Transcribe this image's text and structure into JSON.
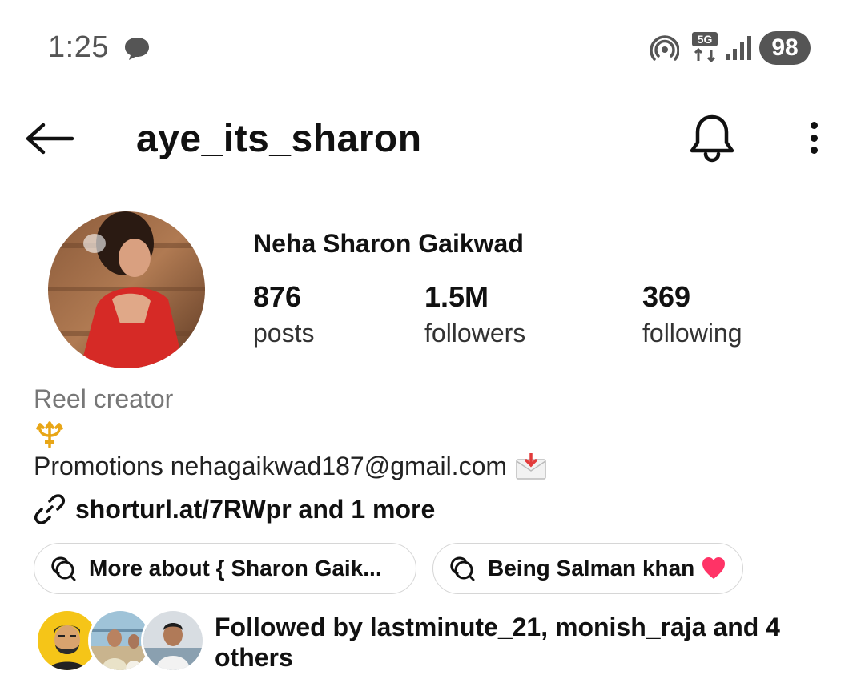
{
  "status_bar": {
    "time": "1:25",
    "network": "5G",
    "battery": "98"
  },
  "header": {
    "username": "aye_its_sharon"
  },
  "profile": {
    "display_name": "Neha Sharon Gaikwad",
    "stats": {
      "posts": {
        "value": "876",
        "label": "posts"
      },
      "followers": {
        "value": "1.5M",
        "label": "followers"
      },
      "following": {
        "value": "369",
        "label": "following"
      }
    },
    "category": "Reel creator",
    "bio_promotions": "Promotions nehagaikwad187@gmail.com",
    "link": "shorturl.at/7RWpr and 1 more"
  },
  "highlights": [
    {
      "label": "More about { Sharon Gaik..."
    },
    {
      "label": "Being Salman khan"
    }
  ],
  "followed_by": {
    "text": "Followed by lastminute_21, monish_raja and 4 others"
  },
  "colors": {
    "status_gray": "#555555",
    "category_gray": "#777777",
    "pill_border": "#d6d6d6",
    "heart": "#ff3366"
  }
}
